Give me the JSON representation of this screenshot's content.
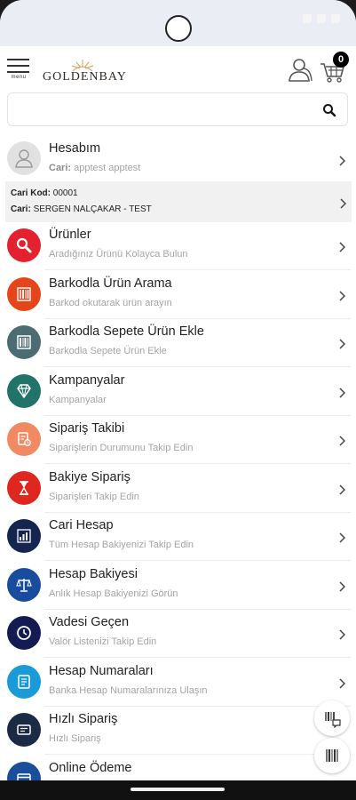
{
  "header": {
    "menu_label": "menu",
    "brand": "GOLDENBAY",
    "cart_count": "0"
  },
  "search": {
    "placeholder": ""
  },
  "account": {
    "title": "Hesabım",
    "subtitle_label": "Cari:",
    "subtitle_value": "apptest apptest"
  },
  "cari": {
    "code_label": "Cari Kod:",
    "code_value": "00001",
    "name_label": "Cari:",
    "name_value": "SERGEN NALÇAKAR - TEST"
  },
  "menu_items": [
    {
      "title": "Ürünler",
      "subtitle": "Aradığınız Ürünü Kolayca Bulun",
      "color": "#e4222f",
      "icon": "search-icon"
    },
    {
      "title": "Barkodla Ürün Arama",
      "subtitle": "Barkod okutarak ürün arayın",
      "color": "#e64419",
      "icon": "barcode-search-icon"
    },
    {
      "title": "Barkodla Sepete Ürün Ekle",
      "subtitle": "Barkodla Sepete Ürün Ekle",
      "color": "#4b6c72",
      "icon": "barcode-icon"
    },
    {
      "title": "Kampanyalar",
      "subtitle": "Kampanyalar",
      "color": "#22746a",
      "icon": "diamond-icon"
    },
    {
      "title": "Sipariş Takibi",
      "subtitle": "Siparişlerin Durumunu Takip Edin",
      "color": "#f18a62",
      "icon": "order-tracking-icon"
    },
    {
      "title": "Bakiye Sipariş",
      "subtitle": "Siparişleri Takip Edin",
      "color": "#e0271f",
      "icon": "hourglass-icon"
    },
    {
      "title": "Cari Hesap",
      "subtitle": "Tüm Hesap Bakiyenizi Takip Edin",
      "color": "#14264f",
      "icon": "bar-chart-icon"
    },
    {
      "title": "Hesap Bakiyesi",
      "subtitle": "Anlık Hesap Bakiyenizi Görün",
      "color": "#1a4c9e",
      "icon": "scale-icon"
    },
    {
      "title": "Vadesi Geçen",
      "subtitle": "Valör Listenizi Takip Edin",
      "color": "#131b52",
      "icon": "clock-icon"
    },
    {
      "title": "Hesap Numaraları",
      "subtitle": "Banka Hesap Numaralarınıza Ulaşın",
      "color": "#1a9bd7",
      "icon": "bank-account-icon"
    },
    {
      "title": "Hızlı Sipariş",
      "subtitle": "Hızlı Sipariş",
      "color": "#1b2a45",
      "icon": "quick-order-icon"
    },
    {
      "title": "Online Ödeme",
      "subtitle": "",
      "color": "#1a4d9a",
      "icon": "payment-icon"
    }
  ],
  "icons": {
    "menu": "hamburger-icon",
    "user": "user-group-icon",
    "cart": "cart-icon",
    "chevron": "chevron-right-icon"
  }
}
